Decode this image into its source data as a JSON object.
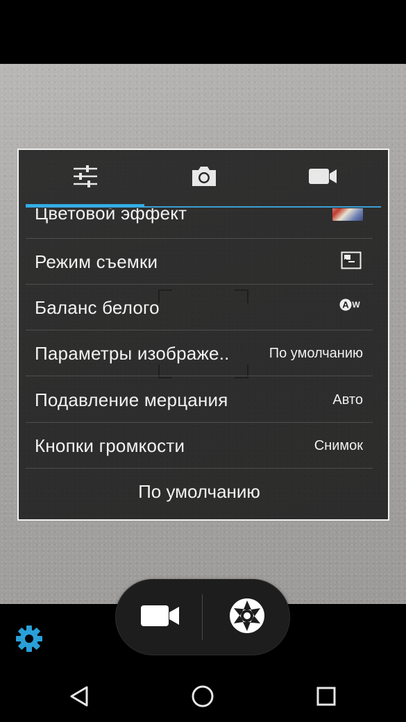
{
  "menu": {
    "tabs": [
      {
        "icon": "sliders-icon"
      },
      {
        "icon": "camera-icon"
      },
      {
        "icon": "video-camera-icon"
      }
    ],
    "active_tab": 0,
    "rows": [
      {
        "label": "Цветовой эффект",
        "icon": "color-effect-thumbnail"
      },
      {
        "label": "Режим съемки",
        "icon": "scene-mode-icon"
      },
      {
        "label": "Баланс белого",
        "icon": "auto-white-balance-icon"
      },
      {
        "label": "Параметры изображе..",
        "value": "По умолчанию"
      },
      {
        "label": "Подавление мерцания",
        "value": "Авто"
      },
      {
        "label": "Кнопки громкости",
        "value": "Снимок"
      }
    ],
    "reset_label": "По умолчанию"
  },
  "controls": {
    "video_icon": "video-camera-icon",
    "shutter_icon": "shutter-icon",
    "settings_icon": "gear-icon"
  },
  "navbar": {
    "back_icon": "back-icon",
    "home_icon": "home-icon",
    "recent_icon": "recent-apps-icon"
  },
  "colors": {
    "accent": "#33aee6",
    "settings_icon": "#2aa0d8",
    "panel_border": "#f2f2f2"
  }
}
